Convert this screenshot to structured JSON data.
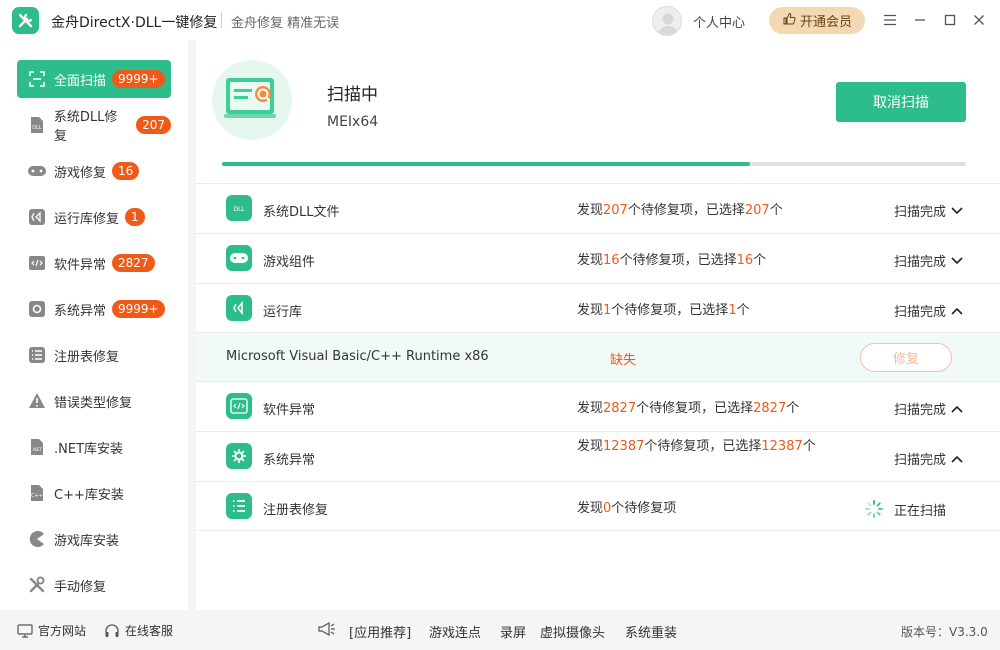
{
  "titlebar": {
    "app_title": "金舟DirectX·DLL一键修复",
    "slogan": "金舟修复 精准无误",
    "user_center": "个人中心",
    "vip_label": "开通会员",
    "icons": [
      "wrench-icon",
      "menu-icon",
      "minimize-icon",
      "maximize-icon",
      "close-icon"
    ]
  },
  "sidebar": {
    "items": [
      {
        "label": "全面扫描",
        "badge": "9999+",
        "icon": "scan-icon"
      },
      {
        "label": "系统DLL修复",
        "badge": "207",
        "icon": "dll-icon"
      },
      {
        "label": "游戏修复",
        "badge": "16",
        "icon": "gamepad-icon"
      },
      {
        "label": "运行库修复",
        "badge": "1",
        "icon": "runtime-icon"
      },
      {
        "label": "软件异常",
        "badge": "2827",
        "icon": "code-icon"
      },
      {
        "label": "系统异常",
        "badge": "9999+",
        "icon": "gear-icon"
      },
      {
        "label": "注册表修复",
        "badge": "",
        "icon": "registry-icon"
      },
      {
        "label": "错误类型修复",
        "badge": "",
        "icon": "warning-icon"
      },
      {
        "label": ".NET库安装",
        "badge": "",
        "icon": "dotnet-icon"
      },
      {
        "label": "C++库安装",
        "badge": "",
        "icon": "cpp-icon"
      },
      {
        "label": "游戏库安装",
        "badge": "",
        "icon": "pacman-icon"
      },
      {
        "label": "手动修复",
        "badge": "",
        "icon": "tools-icon"
      }
    ]
  },
  "scan": {
    "status": "扫描中",
    "current_file": "MEIx64",
    "cancel_label": "取消扫描",
    "progress_percent": 71
  },
  "results": [
    {
      "name": "系统DLL文件",
      "icon": "dll-icon",
      "p1": "发现",
      "found": "207",
      "p2": "个待修复项，已选择",
      "selected": "207",
      "p3": "个",
      "status": "扫描完成",
      "chevron": "chevron-down-icon"
    },
    {
      "name": "游戏组件",
      "icon": "gamepad-icon",
      "p1": "发现",
      "found": "16",
      "p2": "个待修复项，已选择",
      "selected": "16",
      "p3": "个",
      "status": "扫描完成",
      "chevron": "chevron-down-icon"
    },
    {
      "name": "运行库",
      "icon": "runtime-icon",
      "p1": "发现",
      "found": "1",
      "p2": "个待修复项，已选择",
      "selected": "1",
      "p3": "个",
      "status": "扫描完成",
      "chevron": "chevron-up-icon"
    },
    {
      "name": "软件异常",
      "icon": "code-icon",
      "p1": "发现",
      "found": "2827",
      "p2": "个待修复项，已选择",
      "selected": "2827",
      "p3": "个",
      "status": "扫描完成",
      "chevron": "chevron-up-icon"
    },
    {
      "name": "系统异常",
      "icon": "gear-icon",
      "p1": "发现",
      "found": "12387",
      "p2": "个待修复项，已选择",
      "selected": "12387",
      "p3": "个",
      "status": "扫描完成",
      "chevron": "chevron-up-icon"
    },
    {
      "name": "注册表修复",
      "icon": "registry-icon",
      "p1": "发现",
      "found": "0",
      "p2": "个待修复项",
      "selected": "",
      "p3": "",
      "status": "正在扫描",
      "chevron": ""
    }
  ],
  "runtime_detail": {
    "name": "Microsoft Visual Basic/C++ Runtime x86",
    "state": "缺失",
    "repair_label": "修复"
  },
  "footer": {
    "website": "官方网站",
    "service": "在线客服",
    "recommend": "[应用推荐]",
    "links": [
      "游戏连点",
      "录屏",
      "虚拟摄像头",
      "系统重装"
    ],
    "version": "版本号：V3.3.0"
  },
  "colors": {
    "accent": "#2dbd8b",
    "warn": "#f05a19",
    "vip": "#f2d9b3"
  }
}
